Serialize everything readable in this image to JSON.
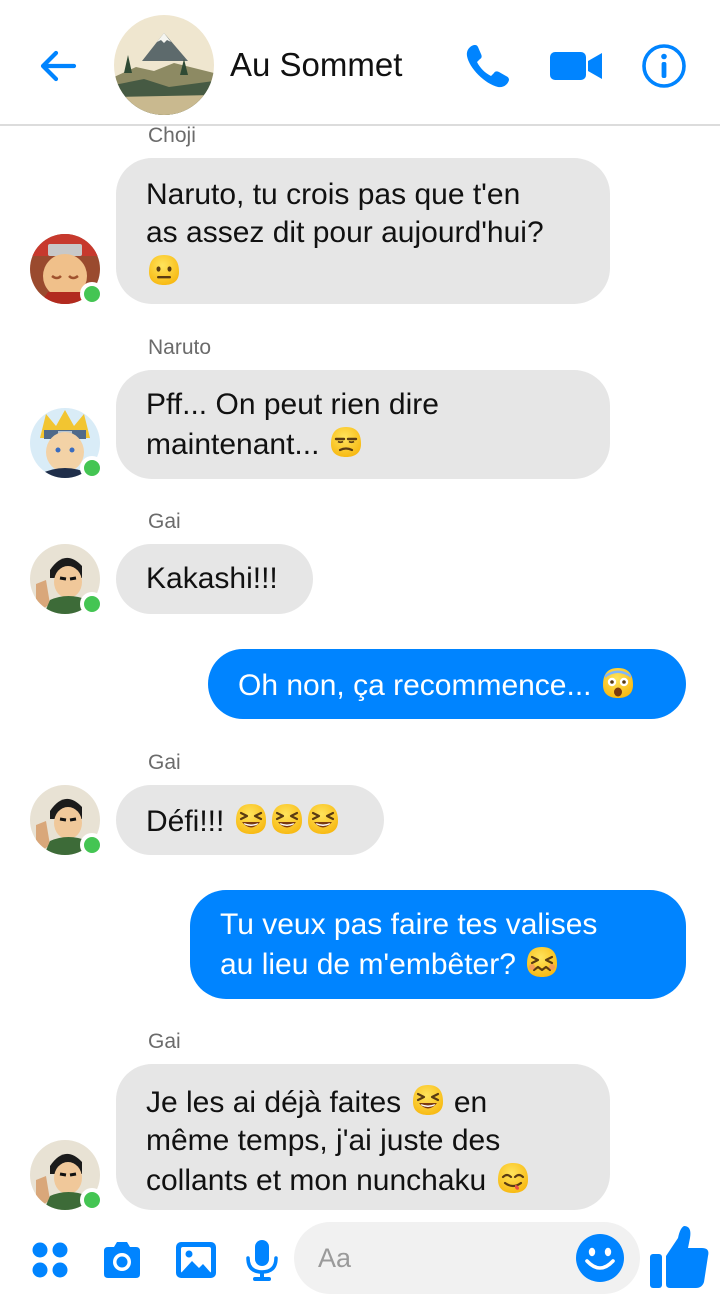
{
  "header": {
    "title": "Au Sommet",
    "accent_color": "#0084ff",
    "icons": [
      "back-arrow-icon",
      "phone-icon",
      "video-camera-icon",
      "info-icon"
    ]
  },
  "messages": [
    {
      "sender": "Choji",
      "direction": "incoming",
      "lines": [
        "Naruto, tu crois pas que t'en",
        "as assez dit pour aujourd'hui?"
      ],
      "emoji": [
        "neutral-face-emoji"
      ]
    },
    {
      "sender": "Naruto",
      "direction": "incoming",
      "lines": [
        "Pff... On peut rien dire",
        "maintenant..."
      ],
      "emoji": [
        "unamused-face-emoji"
      ]
    },
    {
      "sender": "Gai",
      "direction": "incoming",
      "lines": [
        "Kakashi!!!"
      ]
    },
    {
      "direction": "outgoing",
      "lines": [
        "Oh non, ça recommence..."
      ],
      "emoji": [
        "screaming-face-emoji"
      ]
    },
    {
      "sender": "Gai",
      "direction": "incoming",
      "lines": [
        "Défi!!!"
      ],
      "emoji": [
        "squinting-grin-emoji",
        "squinting-grin-emoji",
        "squinting-grin-emoji"
      ]
    },
    {
      "direction": "outgoing",
      "lines": [
        "Tu veux pas faire tes valises",
        "au lieu de m'embêter?"
      ],
      "emoji": [
        "confounded-face-emoji"
      ]
    },
    {
      "sender": "Gai",
      "direction": "incoming",
      "lines": [
        "Je les ai déjà faites",
        "en",
        "même temps, j'ai juste des",
        "collants et mon nunchaku"
      ],
      "emoji": [
        "squinting-grin-emoji",
        "savoring-food-emoji"
      ]
    }
  ],
  "composer": {
    "placeholder": "Aa",
    "icons": [
      "apps-grid-icon",
      "camera-icon",
      "image-icon",
      "microphone-icon",
      "smiley-icon",
      "thumbs-up-icon"
    ]
  },
  "colors": {
    "outgoing_bubble": "#0084ff",
    "incoming_bubble": "#e6e6e6",
    "online_dot": "#44c553"
  }
}
